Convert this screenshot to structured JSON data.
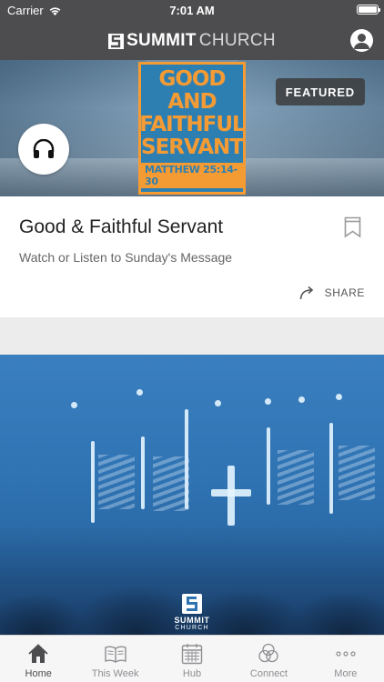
{
  "status_bar": {
    "carrier": "Carrier",
    "time": "7:01 AM",
    "battery_level": 1.0
  },
  "nav": {
    "logo_bold": "SUMMIT",
    "logo_light": "CHURCH"
  },
  "featured": {
    "art_lines": [
      "GOOD AND",
      "FAITHFUL",
      "SERVANT"
    ],
    "art_reference": "MATTHEW 25:14-30",
    "badge": "FEATURED",
    "title": "Good & Faithful Servant",
    "subtitle": "Watch or Listen to Sunday's Message",
    "share_label": "SHARE"
  },
  "second_card": {
    "logo_word": "SUMMIT",
    "logo_word2": "CHURCH"
  },
  "tabs": [
    {
      "label": "Home",
      "icon": "home-icon",
      "active": true
    },
    {
      "label": "This Week",
      "icon": "book-icon",
      "active": false
    },
    {
      "label": "Hub",
      "icon": "calendar-icon",
      "active": false
    },
    {
      "label": "Connect",
      "icon": "connect-circles-icon",
      "active": false
    },
    {
      "label": "More",
      "icon": "more-dots-icon",
      "active": false
    }
  ],
  "colors": {
    "nav_bg": "#4d4d4f",
    "art_orange": "#f59b34",
    "art_blue": "#2e7fb1",
    "tab_active": "#4d4d4f",
    "tab_inactive": "#8e8e93"
  }
}
